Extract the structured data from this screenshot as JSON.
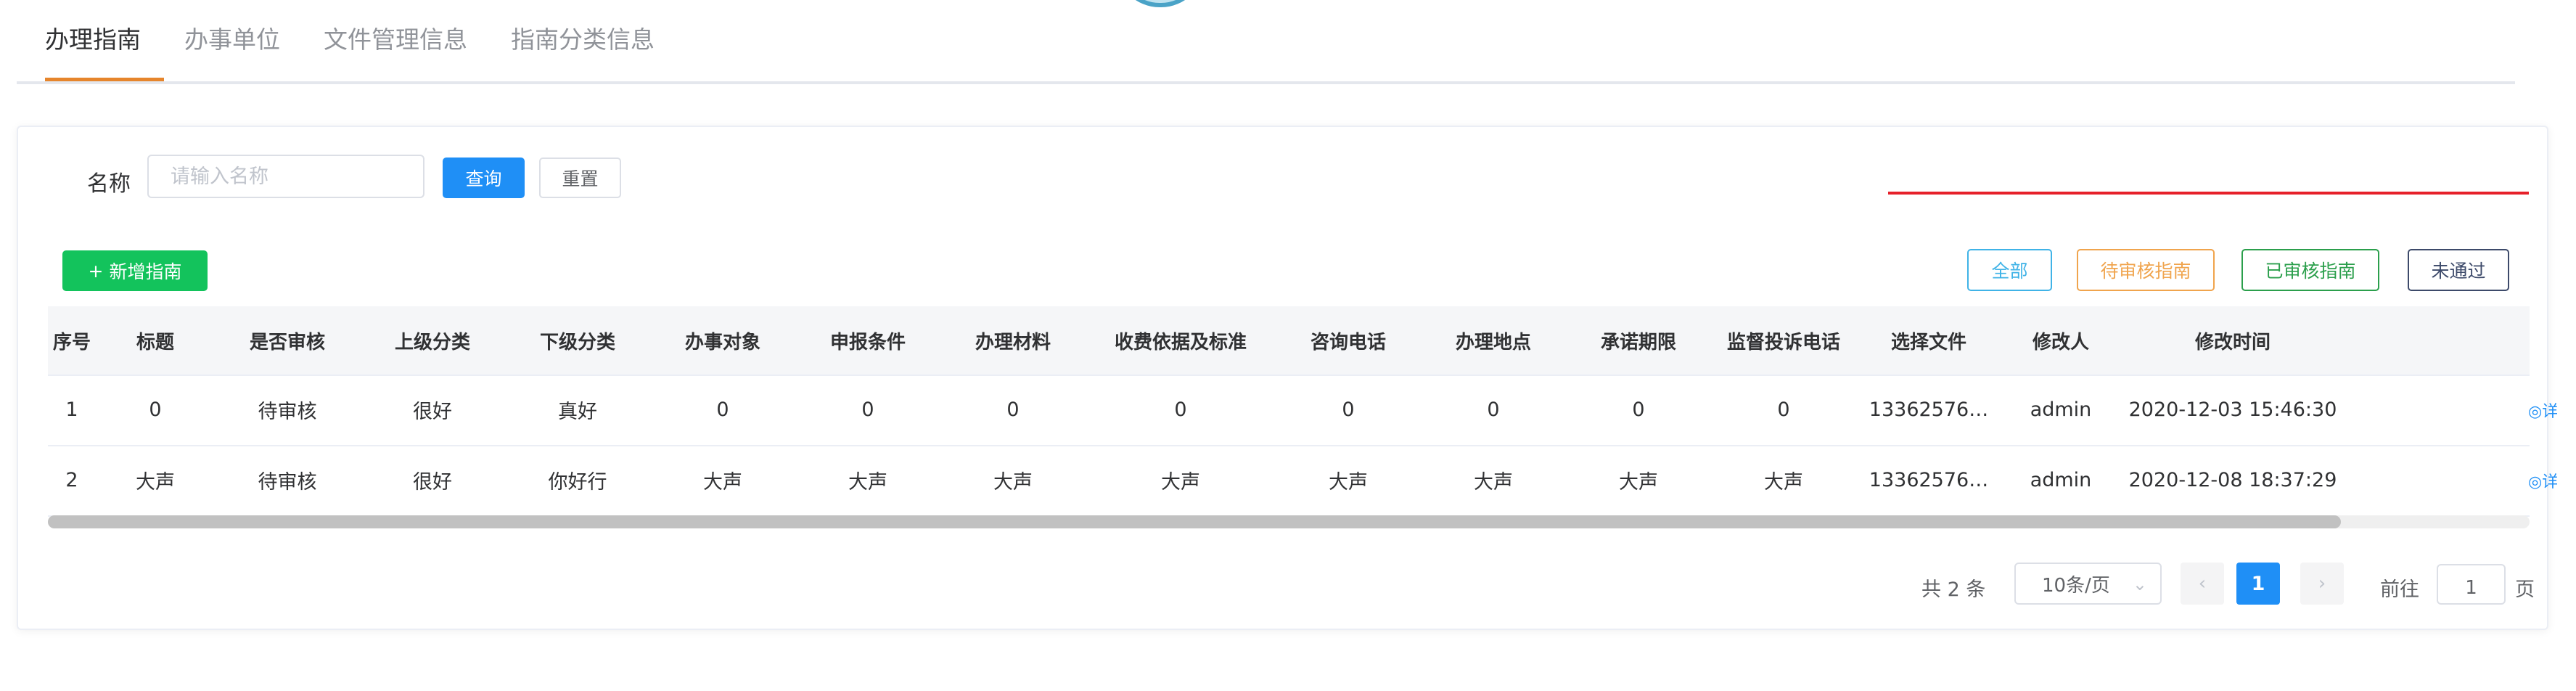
{
  "tabs": [
    {
      "label": "办理指南",
      "active": true
    },
    {
      "label": "办事单位",
      "active": false
    },
    {
      "label": "文件管理信息",
      "active": false
    },
    {
      "label": "指南分类信息",
      "active": false
    }
  ],
  "search": {
    "label": "名称",
    "placeholder": "请输入名称",
    "value": "",
    "query_label": "查询",
    "reset_label": "重置"
  },
  "toolbar": {
    "add_icon": "+",
    "add_label": "新增指南",
    "filters": {
      "all": "全部",
      "pending": "待审核指南",
      "approved": "已审核指南",
      "rejected": "未通过"
    }
  },
  "table": {
    "columns": [
      "序号",
      "标题",
      "是否审核",
      "上级分类",
      "下级分类",
      "办事对象",
      "申报条件",
      "办理材料",
      "收费依据及标准",
      "咨询电话",
      "办理地点",
      "承诺期限",
      "监督投诉电话",
      "选择文件",
      "修改人",
      "修改时间"
    ],
    "rows": [
      {
        "cells": [
          "1",
          "0",
          "待审核",
          "很好",
          "真好",
          "0",
          "0",
          "0",
          "0",
          "0",
          "0",
          "0",
          "0",
          "13362576…",
          "admin",
          "2020-12-03 15:46:30"
        ],
        "op": "◎详"
      },
      {
        "cells": [
          "2",
          "大声",
          "待审核",
          "很好",
          "你好行",
          "大声",
          "大声",
          "大声",
          "大声",
          "大声",
          "大声",
          "大声",
          "大声",
          "13362576…",
          "admin",
          "2020-12-08 18:37:29"
        ],
        "op": "◎详"
      }
    ]
  },
  "pagination": {
    "total": "共 2 条",
    "page_size": "10条/页",
    "prev": "‹",
    "next": "›",
    "current": "1",
    "goto_prefix": "前往",
    "goto_value": "1",
    "goto_suffix": "页"
  },
  "colors": {
    "primary": "#1f8ff6",
    "success": "#13c35c",
    "tab_active_underline": "#e6852c",
    "filter_all": "#40b3e7",
    "filter_pending": "#f0a44d",
    "filter_approved": "#2b9f4c",
    "filter_rejected": "#3d4a6a",
    "annotation_line": "#e6202a"
  },
  "icons": {
    "add": "plus-icon",
    "view": "eye-icon",
    "select": "chevron-down-icon"
  }
}
